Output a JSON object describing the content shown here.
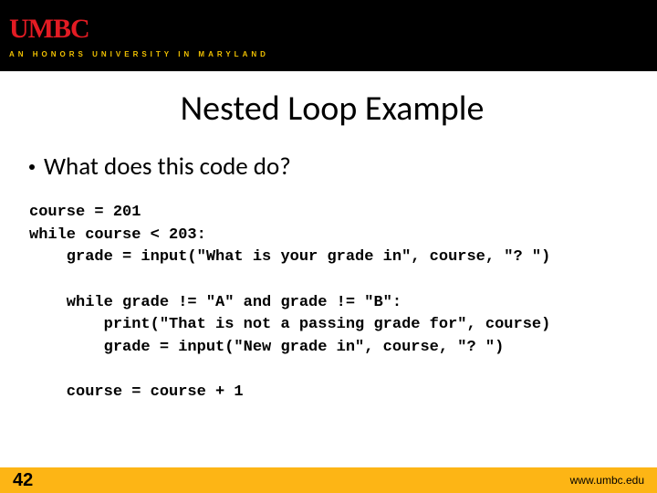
{
  "header": {
    "logo": "UMBC",
    "tagline": "AN HONORS UNIVERSITY IN MARYLAND"
  },
  "title": "Nested Loop Example",
  "bullet": "What does this code do?",
  "code": "course = 201\nwhile course < 203:\n    grade = input(\"What is your grade in\", course, \"? \")\n\n    while grade != \"A\" and grade != \"B\":\n        print(\"That is not a passing grade for\", course)\n        grade = input(\"New grade in\", course, \"? \")\n\n    course = course + 1",
  "footer": {
    "slide_number": "42",
    "url": "www.umbc.edu"
  }
}
